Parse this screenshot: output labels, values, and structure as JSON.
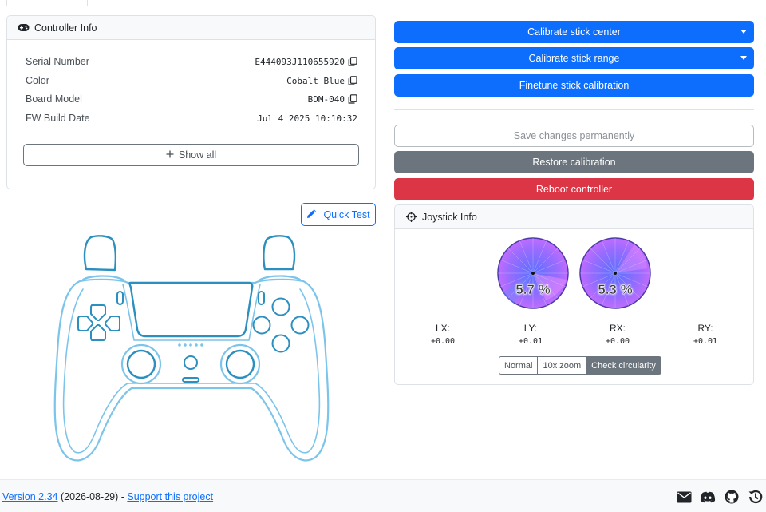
{
  "controller_info": {
    "title": "Controller Info",
    "rows": [
      {
        "label": "Serial Number",
        "value": "E444093J110655920"
      },
      {
        "label": "Color",
        "value": "Cobalt Blue"
      },
      {
        "label": "Board Model",
        "value": "BDM-040"
      },
      {
        "label": "FW Build Date",
        "value": "Jul 4 2025 10:10:32"
      }
    ],
    "show_all_label": "Show all"
  },
  "quick_test_label": "Quick Test",
  "actions": {
    "calibrate_center": "Calibrate stick center",
    "calibrate_range": "Calibrate stick range",
    "finetune": "Finetune stick calibration",
    "save": "Save changes permanently",
    "restore": "Restore calibration",
    "reboot": "Reboot controller"
  },
  "joystick_info": {
    "title": "Joystick Info",
    "left_stick_circularity_error": "5.7 %",
    "right_stick_circularity_error": "5.3 %",
    "axes": [
      {
        "label": "LX:",
        "value": "+0.00"
      },
      {
        "label": "LY:",
        "value": "+0.01"
      },
      {
        "label": "RX:",
        "value": "+0.00"
      },
      {
        "label": "RY:",
        "value": "+0.01"
      }
    ],
    "modes": [
      "Normal",
      "10x zoom",
      "Check circularity"
    ],
    "active_mode": "Check circularity"
  },
  "footer": {
    "version_link": "Version 2.34",
    "date": " (2026-08-29) - ",
    "support_link": "Support this project",
    "icons": [
      "mail-icon",
      "discord-icon",
      "github-icon",
      "history-icon"
    ]
  },
  "colors": {
    "primary": "#0d6efd",
    "secondary": "#6c757d",
    "danger": "#dc3545",
    "controller_outline": "#7cc4ea",
    "controller_accent": "#2b8fbf"
  }
}
